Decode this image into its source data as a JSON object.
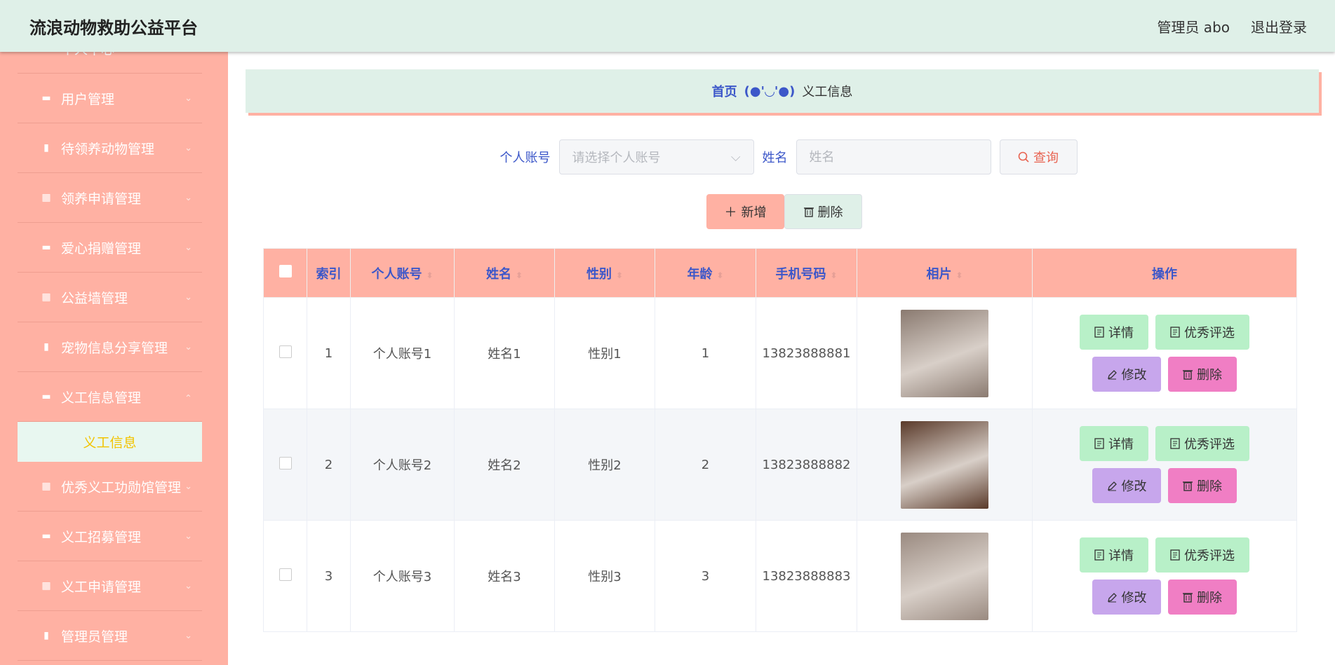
{
  "header": {
    "title": "流浪动物救助公益平台",
    "user_label": "管理员 abo",
    "logout": "退出登录"
  },
  "sidebar": {
    "items": [
      {
        "label": "个人中心",
        "icon": "user-icon",
        "glyph": "▬"
      },
      {
        "label": "用户管理",
        "icon": "monitor-icon",
        "glyph": "▬"
      },
      {
        "label": "待领养动物管理",
        "icon": "clipboard-icon",
        "glyph": "▮"
      },
      {
        "label": "领养申请管理",
        "icon": "grid-icon",
        "glyph": "▦"
      },
      {
        "label": "爱心捐赠管理",
        "icon": "monitor-icon",
        "glyph": "▬"
      },
      {
        "label": "公益墙管理",
        "icon": "grid-icon",
        "glyph": "▦"
      },
      {
        "label": "宠物信息分享管理",
        "icon": "bar-chart-icon",
        "glyph": "▮"
      },
      {
        "label": "义工信息管理",
        "icon": "message-icon",
        "glyph": "▬"
      }
    ],
    "active_sub": "义工信息",
    "items_after": [
      {
        "label": "优秀义工功勋馆管理",
        "icon": "grid-icon",
        "glyph": "▦"
      },
      {
        "label": "义工招募管理",
        "icon": "monitor-icon",
        "glyph": "▬"
      },
      {
        "label": "义工申请管理",
        "icon": "grid-icon",
        "glyph": "▦"
      },
      {
        "label": "管理员管理",
        "icon": "bar-chart-icon",
        "glyph": "▮"
      }
    ]
  },
  "breadcrumb": {
    "home": "首页",
    "separator": "(●'◡'●)",
    "current": "义工信息"
  },
  "search": {
    "account_label": "个人账号",
    "account_placeholder": "请选择个人账号",
    "name_label": "姓名",
    "name_placeholder": "姓名",
    "query_button": "查询"
  },
  "actions": {
    "add": "新增",
    "delete": "删除"
  },
  "table": {
    "headers": [
      "索引",
      "个人账号",
      "姓名",
      "性别",
      "年龄",
      "手机号码",
      "相片",
      "操作"
    ],
    "rows": [
      {
        "index": "1",
        "account": "个人账号1",
        "name": "姓名1",
        "gender": "性别1",
        "age": "1",
        "phone": "13823888881",
        "photo_color": "#8a7a70"
      },
      {
        "index": "2",
        "account": "个人账号2",
        "name": "姓名2",
        "gender": "性别2",
        "age": "2",
        "phone": "13823888882",
        "photo_color": "#5a3a2a"
      },
      {
        "index": "3",
        "account": "个人账号3",
        "name": "姓名3",
        "gender": "性别3",
        "age": "3",
        "phone": "13823888883",
        "photo_color": "#9a8a80"
      }
    ],
    "op_labels": {
      "detail": "详情",
      "excellent": "优秀评选",
      "edit": "修改",
      "delete": "删除"
    }
  }
}
